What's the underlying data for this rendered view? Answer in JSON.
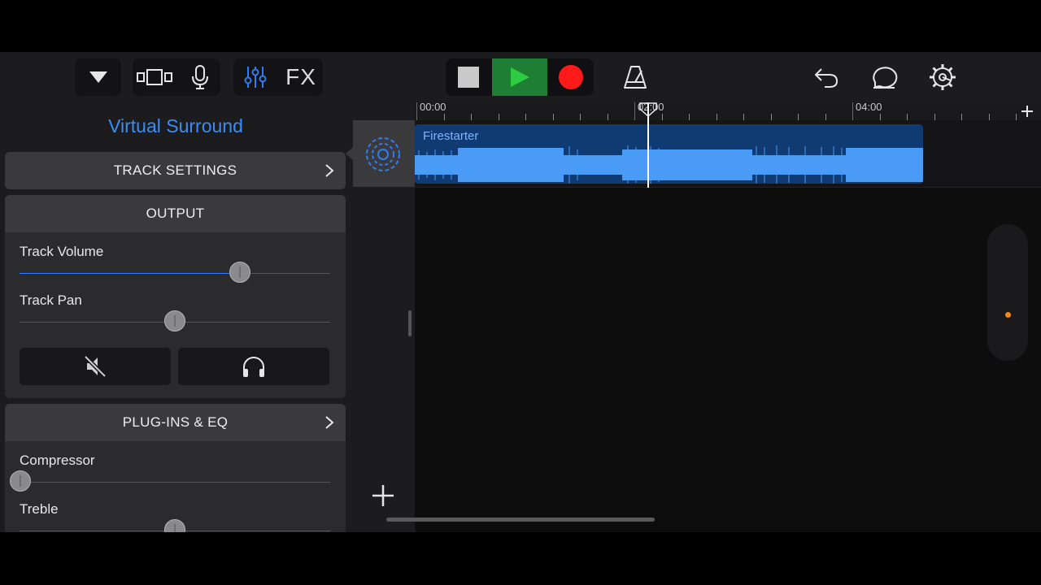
{
  "toolbar": {
    "fx_label": "FX",
    "colors": {
      "play_bg": "#1e7f34",
      "play_icon": "#2ecc40",
      "record": "#ff1a1a",
      "accent": "#2f7df0"
    }
  },
  "left_panel": {
    "title": "Virtual Surround",
    "track_settings": {
      "label": "TRACK SETTINGS"
    },
    "output": {
      "header": "OUTPUT",
      "track_volume": {
        "label": "Track Volume",
        "level": 0.71
      },
      "track_pan": {
        "label": "Track Pan",
        "level": 0.5
      }
    },
    "plugins": {
      "header": "PLUG-INS & EQ",
      "compressor": {
        "label": "Compressor",
        "level": 0.0
      },
      "treble": {
        "label": "Treble",
        "level": 0.5
      }
    }
  },
  "timeline": {
    "ruler_labels": [
      "00:00",
      "02:00",
      "04:00"
    ],
    "region": {
      "name": "Firestarter"
    },
    "playhead_time_fraction": 0.54
  },
  "icons": [
    "dropdown-triangle-icon",
    "tracks-view-icon",
    "microphone-icon",
    "mixer-sliders-icon",
    "stop-icon",
    "play-icon",
    "record-icon",
    "metronome-icon",
    "undo-icon",
    "loop-browser-icon",
    "settings-gear-icon",
    "add-icon",
    "mute-icon",
    "headphones-icon",
    "chevron-right-icon",
    "surround-icon"
  ]
}
